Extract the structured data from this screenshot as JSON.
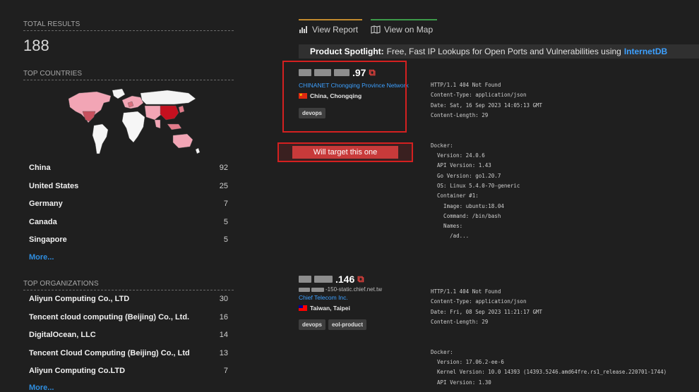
{
  "summary": {
    "total_results_label": "TOTAL RESULTS",
    "total_results": "188"
  },
  "top_countries": {
    "label": "TOP COUNTRIES",
    "items": [
      {
        "name": "China",
        "count": "92"
      },
      {
        "name": "United States",
        "count": "25"
      },
      {
        "name": "Germany",
        "count": "7"
      },
      {
        "name": "Canada",
        "count": "5"
      },
      {
        "name": "Singapore",
        "count": "5"
      }
    ],
    "more": "More..."
  },
  "top_organizations": {
    "label": "TOP ORGANIZATIONS",
    "items": [
      {
        "name": "Aliyun Computing Co., LTD",
        "count": "30"
      },
      {
        "name": "Tencent cloud computing (Beijing) Co., Ltd.",
        "count": "16"
      },
      {
        "name": "DigitalOcean, LLC",
        "count": "14"
      },
      {
        "name": "Tencent Cloud Computing (Beijing) Co., Ltd",
        "count": "13"
      },
      {
        "name": "Aliyun Computing Co.LTD",
        "count": "7"
      }
    ],
    "more": "More..."
  },
  "tabs": [
    {
      "label": "View Report",
      "icon": "report-icon",
      "accent": "#c28a2e"
    },
    {
      "label": "View on Map",
      "icon": "map-icon",
      "accent": "#3c9a4a"
    }
  ],
  "spotlight": {
    "prefix": "Product Spotlight:",
    "text": "Free, Fast IP Lookups for Open Ports and Vulnerabilities using",
    "link": "InternetDB"
  },
  "results": [
    {
      "ip_suffix": ".97",
      "org": "CHINANET Chongqing Province Network",
      "location": "China, Chongqing",
      "tags": [
        "devops"
      ],
      "banner": "HTTP/1.1 404 Not Found\nContent-Type: application/json\nDate: Sat, 16 Sep 2023 14:05:13 GMT\nContent-Length: 29\n\n\nDocker:\n  Version: 24.0.6\n  API Version: 1.43\n  Go Version: go1.20.7\n  OS: Linux 5.4.0-70-generic\n  Container #1:\n    Image: ubuntu:18.04\n    Command: /bin/bash\n    Names:\n      /ad..."
    },
    {
      "ip_suffix": ".146",
      "hostname": "-150-static.chief.net.tw",
      "org": "Chief Telecom Inc.",
      "location": "Taiwan, Taipei",
      "tags": [
        "devops",
        "eol-product"
      ],
      "banner": "HTTP/1.1 404 Not Found\nContent-Type: application/json\nDate: Fri, 08 Sep 2023 11:21:17 GMT\nContent-Length: 29\n\n\nDocker:\n  Version: 17.06.2-ee-6\n  Kernel Version: 10.0 14393 (14393.5246.amd64fre.rs1_release.220701-1744)\n  API Version: 1.30"
    }
  ],
  "annotation": {
    "note": "Will target this one",
    "color": "#d42020"
  }
}
